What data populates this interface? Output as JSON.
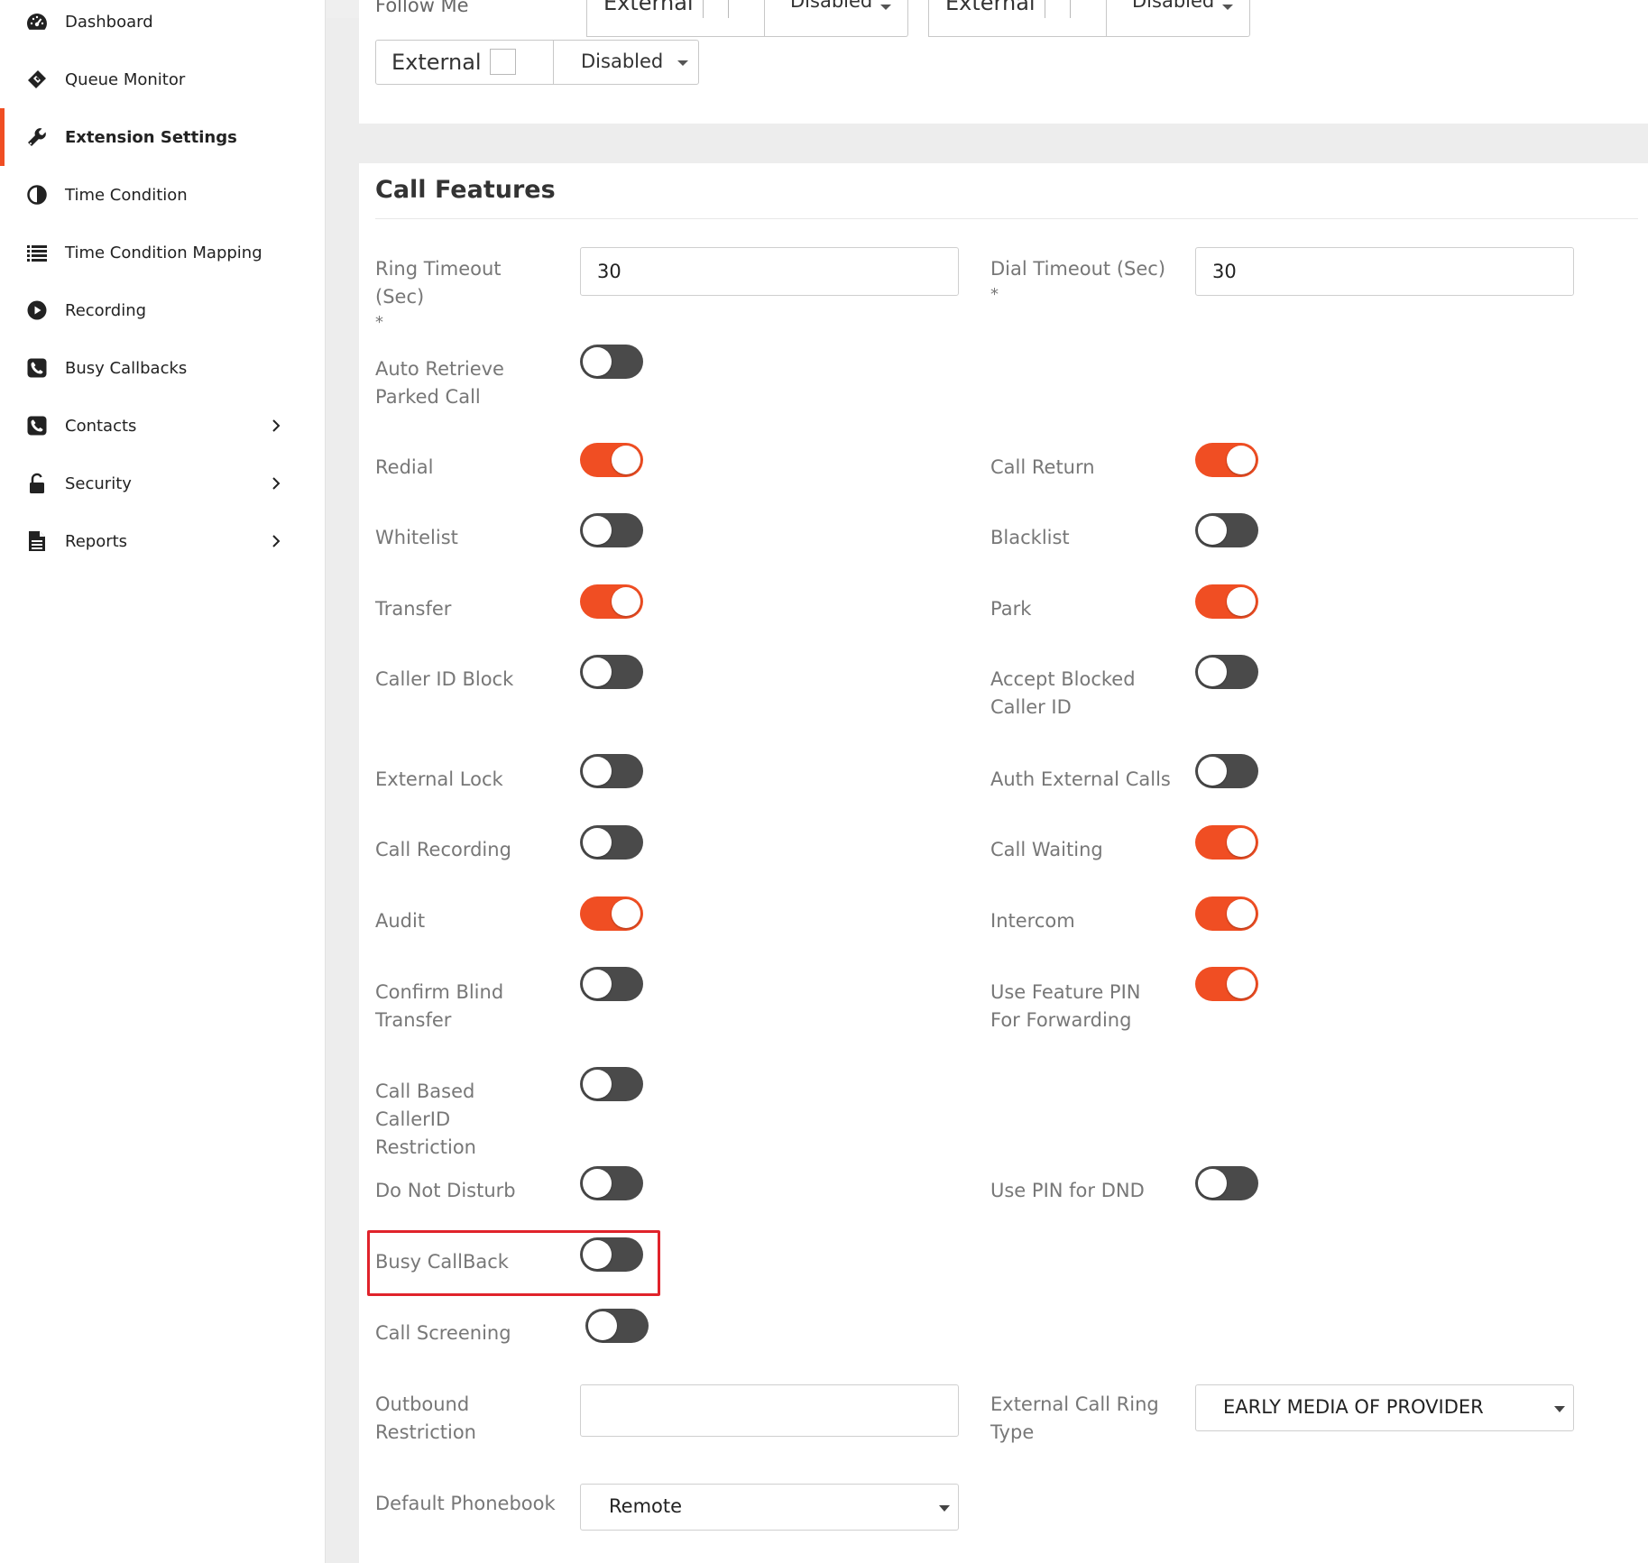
{
  "sidebar": {
    "items": [
      {
        "label": "Dashboard",
        "icon": "dashboard-icon",
        "active": false,
        "chevron": false
      },
      {
        "label": "Queue Monitor",
        "icon": "ticket-icon",
        "active": false,
        "chevron": false
      },
      {
        "label": "Extension Settings",
        "icon": "wrench-icon",
        "active": true,
        "chevron": false
      },
      {
        "label": "Time Condition",
        "icon": "half-circle-icon",
        "active": false,
        "chevron": false
      },
      {
        "label": "Time Condition Mapping",
        "icon": "list-icon",
        "active": false,
        "chevron": false
      },
      {
        "label": "Recording",
        "icon": "play-circle-icon",
        "active": false,
        "chevron": false
      },
      {
        "label": "Busy Callbacks",
        "icon": "phone-square-icon",
        "active": false,
        "chevron": false
      },
      {
        "label": "Contacts",
        "icon": "phone-square-icon",
        "active": false,
        "chevron": true
      },
      {
        "label": "Security",
        "icon": "unlock-icon",
        "active": false,
        "chevron": true
      },
      {
        "label": "Reports",
        "icon": "file-text-icon",
        "active": false,
        "chevron": true
      }
    ]
  },
  "top_card": {
    "follow_me_label": "Follow Me",
    "row1": [
      {
        "type": "External",
        "mode": "Disabled"
      },
      {
        "type": "External",
        "mode": "Disabled"
      }
    ],
    "row2": {
      "type": "External",
      "mode": "Disabled"
    }
  },
  "call_features": {
    "title": "Call Features",
    "ring_timeout": {
      "label": "Ring Timeout (Sec)",
      "required": "*",
      "value": "30"
    },
    "dial_timeout": {
      "label": "Dial Timeout (Sec)",
      "required": "*",
      "value": "30"
    },
    "toggles": {
      "auto_retrieve": {
        "label": "Auto Retrieve Parked Call",
        "on": false
      },
      "redial": {
        "label": "Redial",
        "on": true
      },
      "call_return": {
        "label": "Call Return",
        "on": true
      },
      "whitelist": {
        "label": "Whitelist",
        "on": false
      },
      "blacklist": {
        "label": "Blacklist",
        "on": false
      },
      "transfer": {
        "label": "Transfer",
        "on": true
      },
      "park": {
        "label": "Park",
        "on": true
      },
      "caller_id_block": {
        "label": "Caller ID Block",
        "on": false
      },
      "accept_blocked": {
        "label": "Accept Blocked Caller ID",
        "on": false
      },
      "external_lock": {
        "label": "External Lock",
        "on": false
      },
      "auth_external": {
        "label": "Auth External Calls",
        "on": false
      },
      "call_recording": {
        "label": "Call Recording",
        "on": false
      },
      "call_waiting": {
        "label": "Call Waiting",
        "on": true
      },
      "audit": {
        "label": "Audit",
        "on": true
      },
      "intercom": {
        "label": "Intercom",
        "on": true
      },
      "confirm_blind": {
        "label": "Confirm Blind Transfer",
        "on": false
      },
      "feature_pin": {
        "label": "Use Feature PIN For Forwarding",
        "on": true
      },
      "call_based_cid": {
        "label": "Call Based CallerID Restriction",
        "on": false
      },
      "dnd": {
        "label": "Do Not Disturb",
        "on": false
      },
      "pin_dnd": {
        "label": "Use PIN for DND",
        "on": false
      },
      "busy_callback": {
        "label": "Busy CallBack",
        "on": false
      },
      "call_screening": {
        "label": "Call Screening",
        "on": false
      }
    },
    "outbound_restriction": {
      "label": "Outbound Restriction",
      "value": ""
    },
    "external_ring_type": {
      "label": "External Call Ring Type",
      "value": "EARLY MEDIA OF PROVIDER"
    },
    "default_phonebook": {
      "label": "Default Phonebook",
      "value": "Remote"
    }
  },
  "colors": {
    "accent": "#f04e23",
    "toggle_off": "#4a4a4a",
    "highlight": "#e0232b"
  }
}
